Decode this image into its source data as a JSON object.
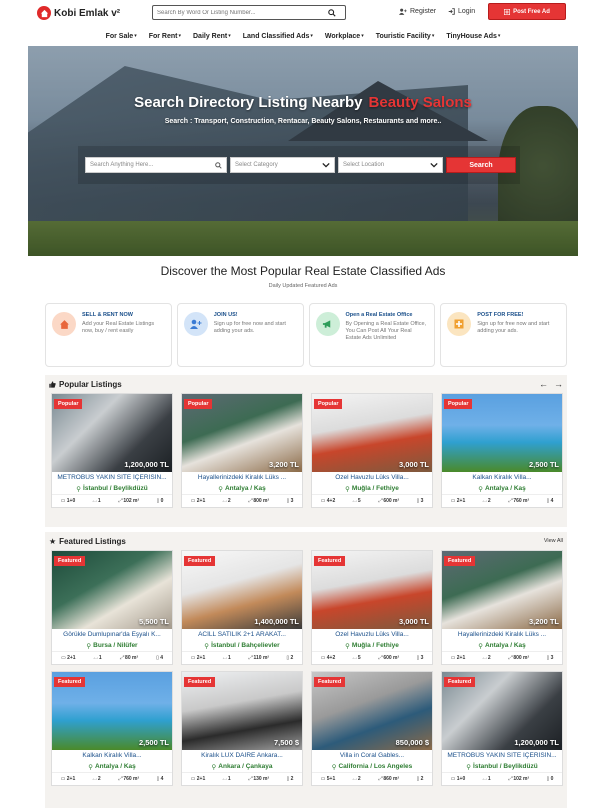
{
  "header": {
    "logo_text": "Kobi Emlak v²",
    "search_placeholder": "Search By Word Or Listing Number...",
    "register_label": "Register",
    "login_label": "Login",
    "post_free_ad_label": "Post Free Ad"
  },
  "nav": {
    "items": [
      "For Sale",
      "For Rent",
      "Daily Rent",
      "Land Classified Ads",
      "Workplace",
      "Touristic Facility",
      "TinyHouse Ads"
    ]
  },
  "hero": {
    "title": "Search Directory Listing Nearby",
    "title_highlight": "Beauty Salons",
    "subtitle": "Search : Transport, Construction, Rentacar, Beauty Salons, Restaurants and more..",
    "search_placeholder": "Search Anything Here...",
    "category_value": "Select Category",
    "location_value": "Select Location",
    "search_button": "Search"
  },
  "discover": {
    "title": "Discover the Most Popular Real Estate Classified Ads",
    "subtitle": "Daily Updated Featured Ads"
  },
  "features": [
    {
      "title": "SELL & RENT NOW",
      "desc": "Add your Real Estate Listings now, buy / rent easily",
      "color": "#f4a27a"
    },
    {
      "title": "JOIN US!",
      "desc": "Sign up for free now and start adding your ads.",
      "color": "#6aa7e8"
    },
    {
      "title": "Open a Real Estate Office",
      "desc": "By Opening a Real Estate Office, You Can Post All Your Real Estate Ads Unlimited",
      "color": "#4cb87a"
    },
    {
      "title": "POST FOR FREE!",
      "desc": "Sign up for free now and start adding your ads.",
      "color": "#f2b04c"
    }
  ],
  "popular": {
    "title": "Popular Listings",
    "cards": [
      {
        "badge": "Popular",
        "price": "1,200,000 TL",
        "name": "METROBÜS YAKIN SİTE İÇERİSİN...",
        "loc": "İstanbul / Beylikdüzü",
        "s1": "1+0",
        "s2": "1",
        "s3": "102 m²",
        "s4": "0"
      },
      {
        "badge": "Popular",
        "price": "3,200 TL",
        "name": "Hayallerinizdeki Kiralık Lüks ...",
        "loc": "Antalya / Kaş",
        "s1": "2+1",
        "s2": "2",
        "s3": "800 m²",
        "s4": "3"
      },
      {
        "badge": "Popular",
        "price": "3,000 TL",
        "name": "Özel Havuzlu Lüks Villa...",
        "loc": "Muğla / Fethiye",
        "s1": "4+2",
        "s2": "5",
        "s3": "600 m²",
        "s4": "3"
      },
      {
        "badge": "Popular",
        "price": "2,500 TL",
        "name": "Kalkan Kiralık Villa...",
        "loc": "Antalya / Kaş",
        "s1": "2+1",
        "s2": "2",
        "s3": "760 m²",
        "s4": "4"
      }
    ]
  },
  "featured": {
    "title": "Featured Listings",
    "view_all": "View All",
    "row1": [
      {
        "badge": "Featured",
        "price": "5,500 TL",
        "name": "Görükle Dumlupınar'da Eşyalı K...",
        "loc": "Bursa / Nilüfer",
        "s1": "2+1",
        "s2": "1",
        "s3": "80 m²",
        "s4": "4"
      },
      {
        "badge": "Featured",
        "price": "1,400,000 TL",
        "name": "ACİLL SATILIK 2+1 ARAKAT...",
        "loc": "İstanbul / Bahçelievler",
        "s1": "2+1",
        "s2": "1",
        "s3": "110 m²",
        "s4": "2"
      },
      {
        "badge": "Featured",
        "price": "3,000 TL",
        "name": "Özel Havuzlu Lüks Villa...",
        "loc": "Muğla / Fethiye",
        "s1": "4+2",
        "s2": "5",
        "s3": "600 m²",
        "s4": "3"
      },
      {
        "badge": "Featured",
        "price": "3,200 TL",
        "name": "Hayallerinizdeki Kiralık Lüks ...",
        "loc": "Antalya / Kaş",
        "s1": "2+1",
        "s2": "2",
        "s3": "800 m²",
        "s4": "3"
      }
    ],
    "row2": [
      {
        "badge": "Featured",
        "price": "2,500 TL",
        "name": "Kalkan Kiralık Villa...",
        "loc": "Antalya / Kaş",
        "s1": "2+1",
        "s2": "2",
        "s3": "760 m²",
        "s4": "4"
      },
      {
        "badge": "Featured",
        "price": "7,500 $",
        "name": "Kiralık LUX DAİRE Ankara...",
        "loc": "Ankara / Çankaya",
        "s1": "2+1",
        "s2": "1",
        "s3": "130 m²",
        "s4": "2"
      },
      {
        "badge": "Featured",
        "price": "850,000 $",
        "name": "Villa in Coral Gables...",
        "loc": "California / Los Angeles",
        "s1": "5+1",
        "s2": "2",
        "s3": "860 m²",
        "s4": "2"
      },
      {
        "badge": "Featured",
        "price": "1,200,000 TL",
        "name": "METROBÜS YAKIN SİTE İÇERİSİN...",
        "loc": "İstanbul / Beylikdüzü",
        "s1": "1+0",
        "s2": "1",
        "s3": "102 m²",
        "s4": "0"
      }
    ]
  },
  "colors": {
    "accent": "#e53535",
    "link": "#1a4f8a",
    "location": "#2e7d32"
  }
}
